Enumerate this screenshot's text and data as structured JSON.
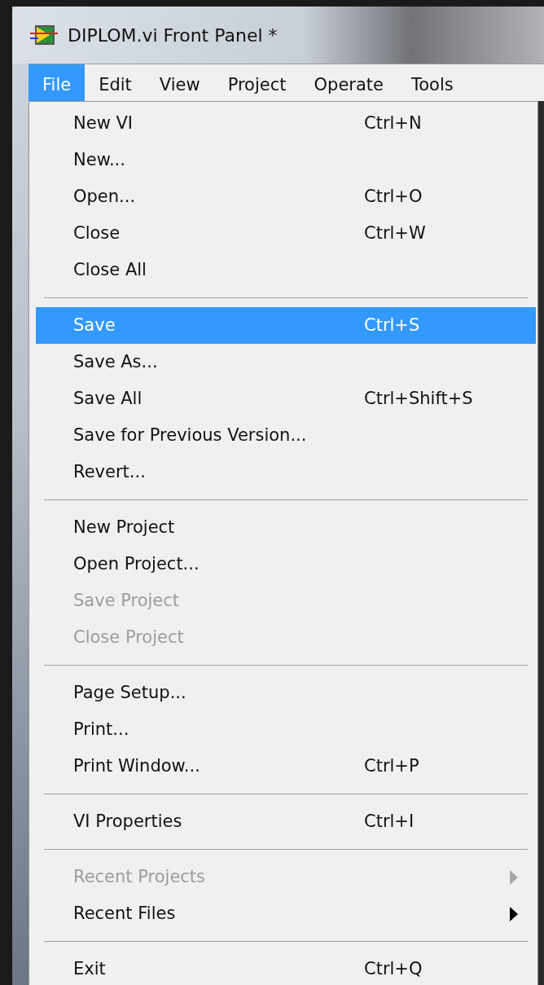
{
  "window": {
    "title": "DIPLOM.vi Front Panel *"
  },
  "menu_bar": [
    {
      "label": "File",
      "selected": true
    },
    {
      "label": "Edit",
      "selected": false
    },
    {
      "label": "View",
      "selected": false
    },
    {
      "label": "Project",
      "selected": false
    },
    {
      "label": "Operate",
      "selected": false
    },
    {
      "label": "Tools",
      "selected": false
    }
  ],
  "file_menu": [
    {
      "items": [
        {
          "label": "New VI",
          "shortcut": "Ctrl+N",
          "selected": false,
          "disabled": false
        },
        {
          "label": "New...",
          "selected": false,
          "disabled": false
        },
        {
          "label": "Open...",
          "shortcut": "Ctrl+O",
          "selected": false,
          "disabled": false
        },
        {
          "label": "Close",
          "shortcut": "Ctrl+W",
          "selected": false,
          "disabled": false
        },
        {
          "label": "Close All",
          "selected": false,
          "disabled": false
        }
      ]
    },
    {
      "items": [
        {
          "label": "Save",
          "shortcut": "Ctrl+S",
          "selected": true,
          "disabled": false
        },
        {
          "label": "Save As...",
          "selected": false,
          "disabled": false
        },
        {
          "label": "Save All",
          "shortcut": "Ctrl+Shift+S",
          "selected": false,
          "disabled": false
        },
        {
          "label": "Save for Previous Version...",
          "selected": false,
          "disabled": false
        },
        {
          "label": "Revert...",
          "selected": false,
          "disabled": false
        }
      ]
    },
    {
      "items": [
        {
          "label": "New Project",
          "selected": false,
          "disabled": false
        },
        {
          "label": "Open Project...",
          "selected": false,
          "disabled": false
        },
        {
          "label": "Save Project",
          "selected": false,
          "disabled": true
        },
        {
          "label": "Close Project",
          "selected": false,
          "disabled": true
        }
      ]
    },
    {
      "items": [
        {
          "label": "Page Setup...",
          "selected": false,
          "disabled": false
        },
        {
          "label": "Print...",
          "selected": false,
          "disabled": false
        },
        {
          "label": "Print Window...",
          "shortcut": "Ctrl+P",
          "selected": false,
          "disabled": false
        }
      ]
    },
    {
      "items": [
        {
          "label": "VI Properties",
          "shortcut": "Ctrl+I",
          "selected": false,
          "disabled": false
        }
      ]
    },
    {
      "items": [
        {
          "label": "Recent Projects",
          "submenu": true,
          "selected": false,
          "disabled": true
        },
        {
          "label": "Recent Files",
          "submenu": true,
          "selected": false,
          "disabled": false
        }
      ]
    },
    {
      "items": [
        {
          "label": "Exit",
          "shortcut": "Ctrl+Q",
          "selected": false,
          "disabled": false
        }
      ]
    }
  ]
}
